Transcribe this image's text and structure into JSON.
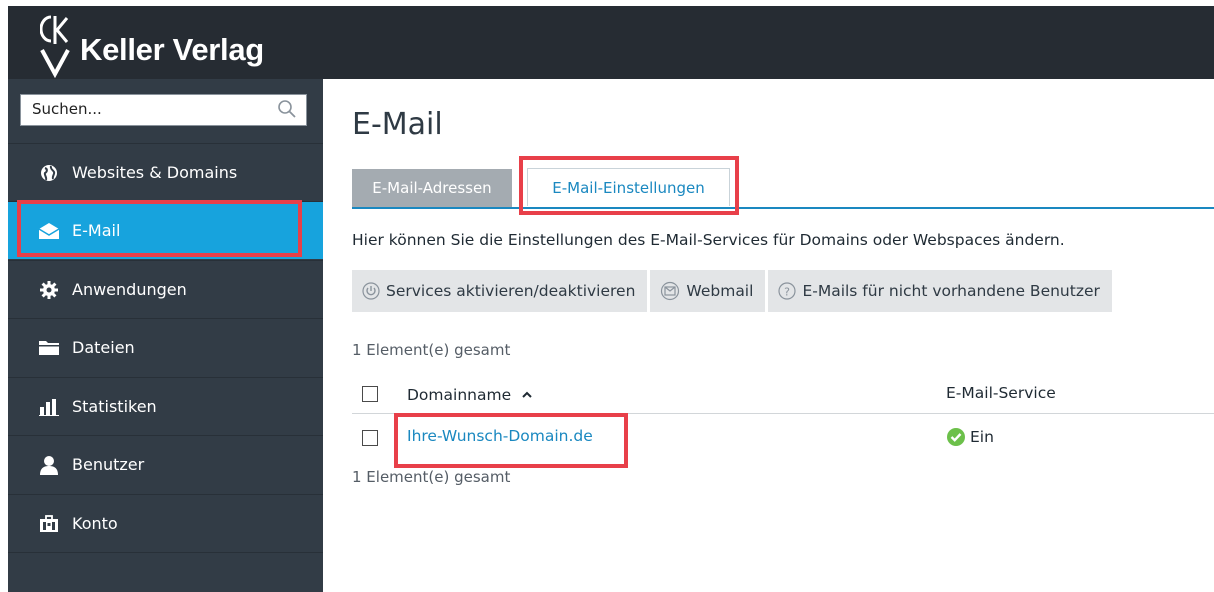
{
  "brand": {
    "name": "Keller Verlag"
  },
  "search": {
    "placeholder": "Suchen..."
  },
  "sidebar": {
    "items": [
      {
        "label": "Websites & Domains",
        "icon": "globe-icon"
      },
      {
        "label": "E-Mail",
        "icon": "envelope-icon",
        "active": true
      },
      {
        "label": "Anwendungen",
        "icon": "gear-icon"
      },
      {
        "label": "Dateien",
        "icon": "folder-icon"
      },
      {
        "label": "Statistiken",
        "icon": "bar-chart-icon"
      },
      {
        "label": "Benutzer",
        "icon": "user-icon"
      },
      {
        "label": "Konto",
        "icon": "briefcase-icon"
      }
    ]
  },
  "main": {
    "title": "E-Mail",
    "tabs": [
      {
        "label": "E-Mail-Adressen",
        "active": false
      },
      {
        "label": "E-Mail-Einstellungen",
        "active": true
      }
    ],
    "description": "Hier können Sie die Einstellungen des E-Mail-Services für Domains oder Webspaces ändern.",
    "toolbar": [
      {
        "label": "Services aktivieren/deaktivieren",
        "icon": "power-icon"
      },
      {
        "label": "Webmail",
        "icon": "webmail-icon"
      },
      {
        "label": "E-Mails für nicht vorhandene Benutzer",
        "icon": "help-icon"
      }
    ],
    "count_top": "1 Element(e) gesamt",
    "count_bottom": "1 Element(e) gesamt",
    "table": {
      "columns": [
        "Domainname",
        "E-Mail-Service"
      ],
      "rows": [
        {
          "domain": "Ihre-Wunsch-Domain.de",
          "status": "Ein"
        }
      ]
    }
  },
  "colors": {
    "topbar": "#262c33",
    "sidebar": "#323c46",
    "active": "#17a3dd",
    "accent": "#1a88c0",
    "highlight": "#e83f49",
    "status_ok": "#6cc04a"
  }
}
